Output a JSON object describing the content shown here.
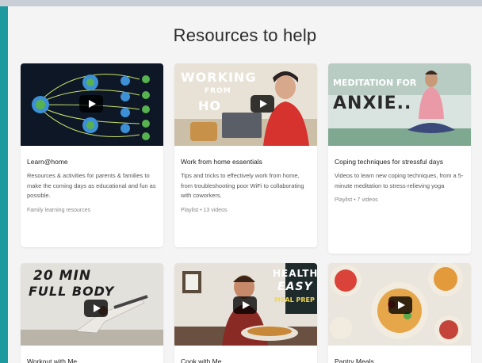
{
  "page": {
    "title": "Resources to help",
    "accent_color": "#1d9aa0"
  },
  "cards": [
    {
      "title": "Learn@home",
      "description": "Resources & activities for parents & families to make the coming days as educational and fun as possible.",
      "meta": "Family learning resources",
      "icon": "play-icon"
    },
    {
      "title": "Work from home essentials",
      "description": "Tips and tricks to effectively work from home, from troubleshooting poor WiFi to collaborating with coworkers.",
      "meta": "Playlist • 13 videos",
      "thumb_text": [
        "WORKING",
        "FROM",
        "HO"
      ],
      "icon": "play-icon"
    },
    {
      "title": "Coping techniques for stressful days",
      "description": "Videos to learn new coping techniques, from a 5-minute meditation to stress-relieving yoga",
      "meta": "Playlist • 7 videos",
      "thumb_text": [
        "MEDITATION FOR",
        "ANXIE.."
      ],
      "icon": "play-icon"
    },
    {
      "title": "Workout with Me",
      "thumb_text": [
        "20 MIN",
        "FULL BODY"
      ],
      "icon": "play-icon"
    },
    {
      "title": "Cook with Me",
      "thumb_text": [
        "HEALTHY",
        "EASY",
        "MEAL PREP"
      ],
      "icon": "play-icon"
    },
    {
      "title": "Pantry Meals",
      "icon": "play-icon"
    }
  ]
}
